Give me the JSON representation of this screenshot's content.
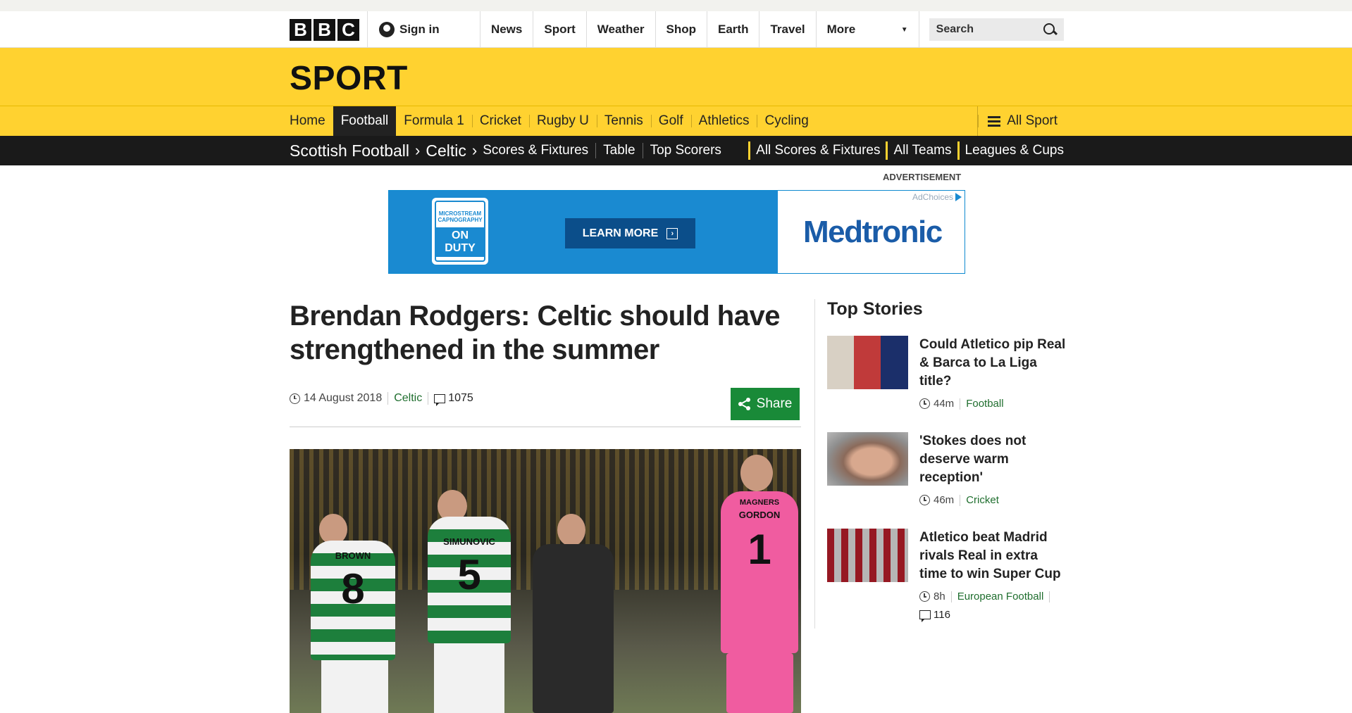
{
  "brand": {
    "letters": [
      "B",
      "B",
      "C"
    ]
  },
  "account": {
    "signin_label": "Sign in"
  },
  "global_nav": [
    {
      "label": "News"
    },
    {
      "label": "Sport"
    },
    {
      "label": "Weather"
    },
    {
      "label": "Shop"
    },
    {
      "label": "Earth"
    },
    {
      "label": "Travel"
    },
    {
      "label": "More"
    }
  ],
  "search": {
    "placeholder": "Search"
  },
  "section": {
    "title": "SPORT"
  },
  "sport_nav": {
    "items": [
      {
        "label": "Home"
      },
      {
        "label": "Football",
        "active": true
      },
      {
        "label": "Formula 1"
      },
      {
        "label": "Cricket"
      },
      {
        "label": "Rugby U"
      },
      {
        "label": "Tennis"
      },
      {
        "label": "Golf"
      },
      {
        "label": "Athletics"
      },
      {
        "label": "Cycling"
      }
    ],
    "all_sport": "All Sport"
  },
  "sub_nav": {
    "crumbs": [
      "Scottish Football",
      "Celtic"
    ],
    "links": [
      "Scores & Fixtures",
      "Table",
      "Top Scorers"
    ],
    "right_links": [
      "All Scores & Fixtures",
      "All Teams",
      "Leagues & Cups"
    ]
  },
  "advert": {
    "label": "ADVERTISEMENT",
    "badge_lines": [
      "MICROSTREAM",
      "CAPNOGRAPHY"
    ],
    "badge_duty": "ON DUTY",
    "cta": "LEARN MORE",
    "adchoices": "AdChoices",
    "brand": "Medtronic"
  },
  "article": {
    "headline": "Brendan Rodgers: Celtic should have strengthened in the summer",
    "date": "14 August 2018",
    "topic": "Celtic",
    "comments": "1075",
    "share_label": "Share",
    "hero": {
      "players": [
        {
          "name": "BROWN",
          "number": "8"
        },
        {
          "name": "SIMUNOVIC",
          "number": "5"
        },
        {
          "name": "GORDON",
          "number": "1"
        }
      ],
      "sponsor": "MAGNERS"
    }
  },
  "top_stories": {
    "title": "Top Stories",
    "items": [
      {
        "title": "Could Atletico pip Real & Barca to La Liga title?",
        "time": "44m",
        "topic": "Football",
        "comments": ""
      },
      {
        "title": "'Stokes does not deserve warm reception'",
        "time": "46m",
        "topic": "Cricket",
        "comments": ""
      },
      {
        "title": "Atletico beat Madrid rivals Real in extra time to win Super Cup",
        "time": "8h",
        "topic": "European Football",
        "comments": "116"
      }
    ]
  },
  "colors": {
    "sport_yellow": "#ffd230",
    "subnav_black": "#1a1a1a",
    "link_green": "#1f6e2e",
    "share_green": "#198a38",
    "ad_blue": "#1a8ad1"
  }
}
